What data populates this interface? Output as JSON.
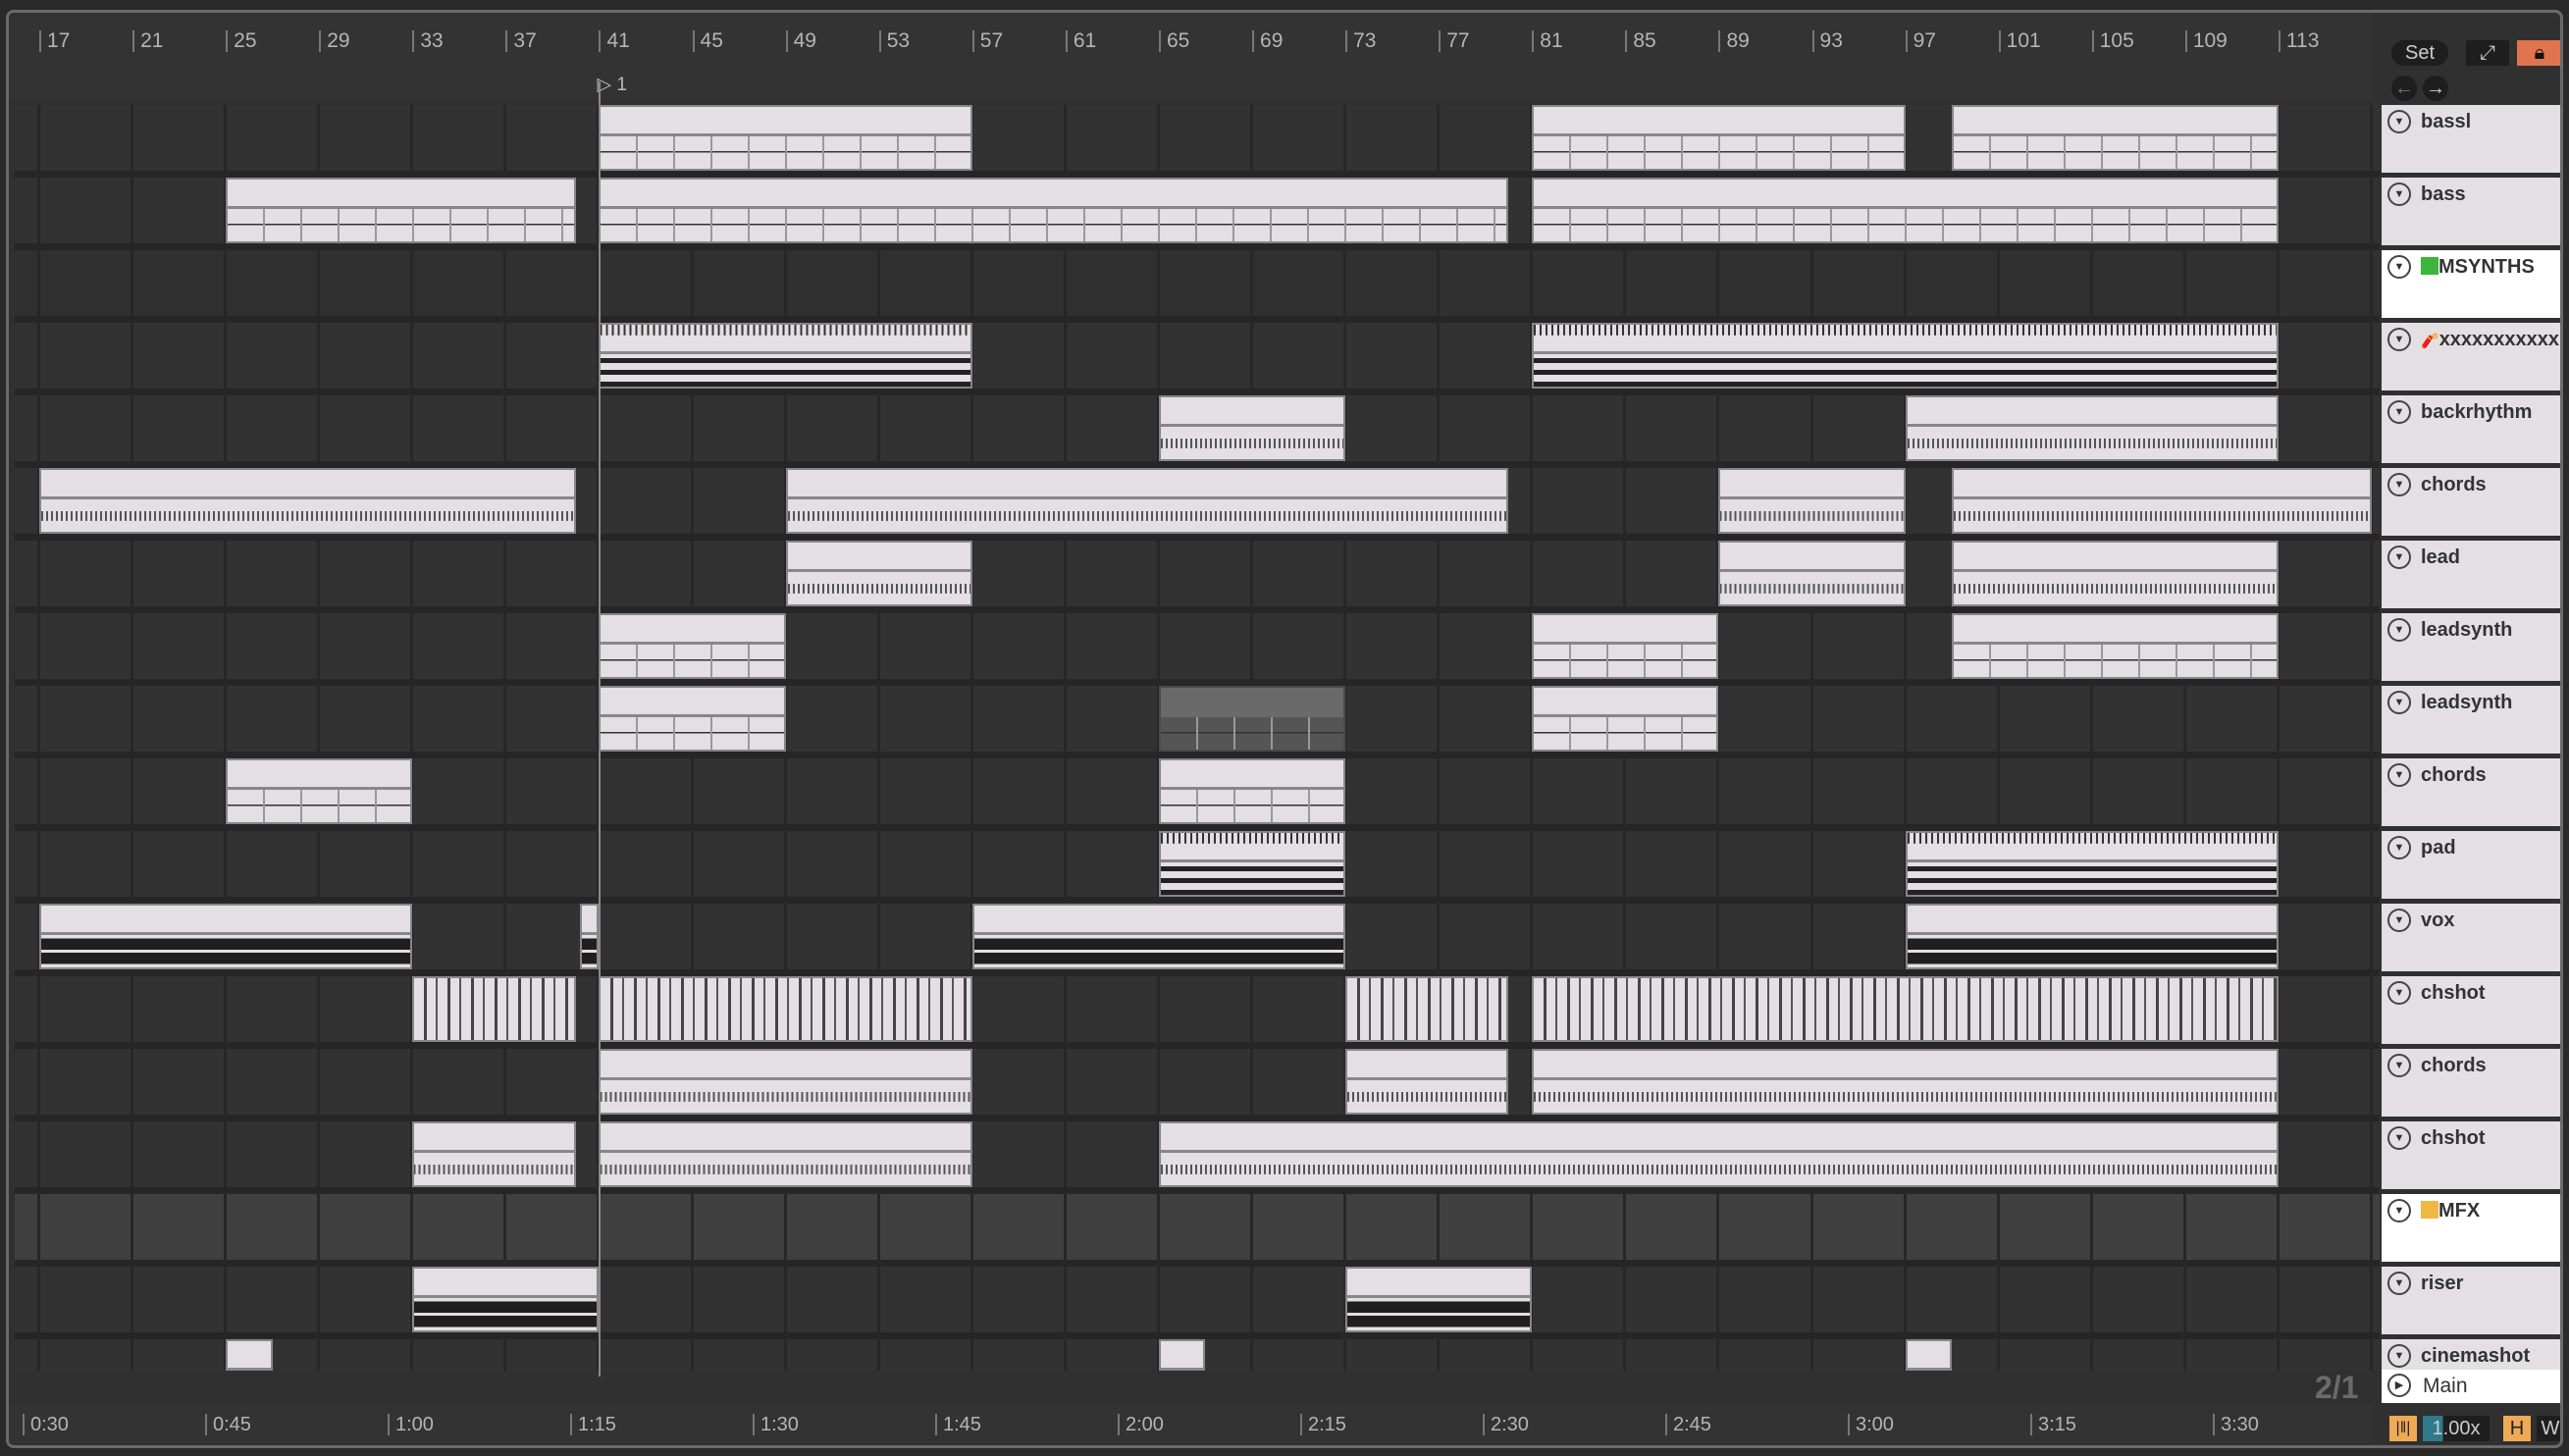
{
  "ruler": {
    "bars": [
      "17",
      "21",
      "25",
      "29",
      "33",
      "37",
      "41",
      "45",
      "49",
      "53",
      "57",
      "61",
      "65",
      "69",
      "73",
      "77",
      "81",
      "85",
      "89",
      "93",
      "97",
      "101",
      "105",
      "109",
      "113"
    ],
    "loop_marker": "1"
  },
  "time_ruler": [
    "0:30",
    "0:45",
    "1:00",
    "1:15",
    "1:30",
    "1:45",
    "2:00",
    "2:15",
    "2:30",
    "2:45",
    "3:00",
    "3:15",
    "3:30"
  ],
  "controls": {
    "set_label": "Set",
    "back_icon": "arrow-left",
    "forward_icon": "arrow-right",
    "unfold_icon": "expand",
    "lock_icon": "lock",
    "time_signature": "2/1",
    "main_label": "Main",
    "tempo_multiplier": "1.00x",
    "h_label": "H",
    "w_label": "W",
    "accent": "#e07350",
    "toggle_on": "#f0a955",
    "tempo_fill": "#2e7a8a"
  },
  "tracks": [
    {
      "name": "bassl",
      "kind": "notes",
      "clips": [
        [
          41,
          57
        ],
        [
          81,
          97
        ],
        [
          99,
          113
        ]
      ]
    },
    {
      "name": "bass",
      "kind": "notes",
      "clips": [
        [
          25,
          40
        ],
        [
          41,
          80
        ],
        [
          81,
          113
        ]
      ]
    },
    {
      "name": "MSYNTHS",
      "group": true,
      "swatch": "#3cb53c",
      "clips": []
    },
    {
      "name": "xxxxxxxxxxx",
      "icon": "firecracker",
      "kind": "dense",
      "clips": [
        [
          41,
          57
        ],
        [
          81,
          113
        ]
      ]
    },
    {
      "name": "backrhythm",
      "kind": "dotted",
      "clips": [
        [
          65,
          73
        ],
        [
          97,
          113
        ]
      ]
    },
    {
      "name": "chords",
      "kind": "dotted",
      "clips": [
        [
          17,
          40
        ],
        [
          49,
          80
        ],
        [
          89,
          97
        ],
        [
          99,
          117
        ]
      ]
    },
    {
      "name": "lead",
      "kind": "dotted",
      "clips": [
        [
          49,
          57
        ],
        [
          89,
          97
        ],
        [
          99,
          113
        ]
      ]
    },
    {
      "name": "leadsynth",
      "kind": "notes",
      "clips": [
        [
          41,
          49
        ],
        [
          81,
          89
        ],
        [
          99,
          113
        ]
      ]
    },
    {
      "name": "leadsynth",
      "kind": "notes",
      "clips": [
        [
          41,
          49
        ],
        [
          65,
          73,
          "muted"
        ],
        [
          81,
          89
        ]
      ]
    },
    {
      "name": "chords",
      "kind": "notes",
      "clips": [
        [
          25,
          33
        ],
        [
          65,
          73
        ]
      ]
    },
    {
      "name": "pad",
      "kind": "dense",
      "clips": [
        [
          65,
          73
        ],
        [
          97,
          113
        ]
      ]
    },
    {
      "name": "vox",
      "kind": "audio",
      "clips": [
        [
          17,
          33
        ],
        [
          40.2,
          41
        ],
        [
          57,
          73
        ],
        [
          97,
          113
        ]
      ]
    },
    {
      "name": "chshot",
      "kind": "shot",
      "clips": [
        [
          33,
          40
        ],
        [
          41,
          57
        ],
        [
          73,
          80
        ],
        [
          81,
          113
        ]
      ]
    },
    {
      "name": "chords",
      "kind": "dotted",
      "clips": [
        [
          41,
          57
        ],
        [
          73,
          80
        ],
        [
          81,
          113
        ]
      ]
    },
    {
      "name": "chshot",
      "kind": "dotted",
      "clips": [
        [
          33,
          40
        ],
        [
          41,
          57
        ],
        [
          65,
          113
        ]
      ]
    },
    {
      "name": "MFX",
      "group": true,
      "mfx": true,
      "swatch": "#f0b840",
      "clips": []
    },
    {
      "name": "riser",
      "kind": "audio",
      "clips": [
        [
          33,
          41
        ],
        [
          73,
          81
        ]
      ]
    },
    {
      "name": "cinemashot",
      "kind": "notes",
      "clips": [
        [
          25,
          27
        ],
        [
          65,
          67
        ],
        [
          97,
          99
        ]
      ]
    }
  ]
}
